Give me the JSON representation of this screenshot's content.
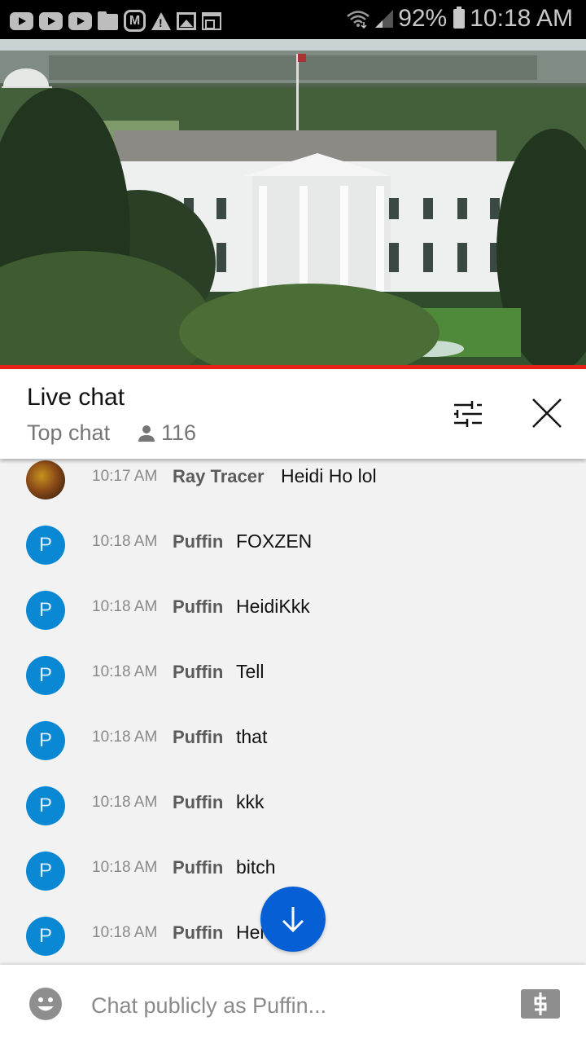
{
  "status_bar": {
    "notification_icons": [
      "youtube-icon",
      "youtube-icon",
      "youtube-icon",
      "folder-icon",
      "m-app-icon",
      "warning-icon",
      "image-icon",
      "news-icon"
    ],
    "wifi_icon": "wifi-icon",
    "signal_icon": "signal-icon",
    "battery_percent": "92%",
    "battery_icon": "battery-icon",
    "time": "10:18 AM"
  },
  "video": {
    "description": "Live camera view of the White House north facade",
    "progress": 1.0,
    "progress_color": "#e62117"
  },
  "chat_header": {
    "title": "Live chat",
    "mode": "Top chat",
    "viewer_icon": "person-icon",
    "viewer_count": "116",
    "filter_icon": "tune-icon",
    "close_icon": "close-icon"
  },
  "messages": [
    {
      "avatar": "photo",
      "avatar_letter": "",
      "time": "10:17 AM",
      "author": "Ray Tracer",
      "text": "Heidi Ho lol"
    },
    {
      "avatar": "letter",
      "avatar_letter": "P",
      "time": "10:18 AM",
      "author": "Puffin",
      "text": "FOXZEN"
    },
    {
      "avatar": "letter",
      "avatar_letter": "P",
      "time": "10:18 AM",
      "author": "Puffin",
      "text": "HeidiKkk"
    },
    {
      "avatar": "letter",
      "avatar_letter": "P",
      "time": "10:18 AM",
      "author": "Puffin",
      "text": "Tell"
    },
    {
      "avatar": "letter",
      "avatar_letter": "P",
      "time": "10:18 AM",
      "author": "Puffin",
      "text": "that"
    },
    {
      "avatar": "letter",
      "avatar_letter": "P",
      "time": "10:18 AM",
      "author": "Puffin",
      "text": "kkk"
    },
    {
      "avatar": "letter",
      "avatar_letter": "P",
      "time": "10:18 AM",
      "author": "Puffin",
      "text": "bitch"
    },
    {
      "avatar": "letter",
      "avatar_letter": "P",
      "time": "10:18 AM",
      "author": "Puffin",
      "text": "Hei"
    }
  ],
  "avatar_color": "#0a88d4",
  "scroll_button": {
    "icon": "arrow-down-icon",
    "color": "#065fd4"
  },
  "input_bar": {
    "emoji_icon": "emoji-icon",
    "placeholder": "Chat publicly as Puffin...",
    "value": "",
    "superchat_icon": "dollar-icon"
  }
}
